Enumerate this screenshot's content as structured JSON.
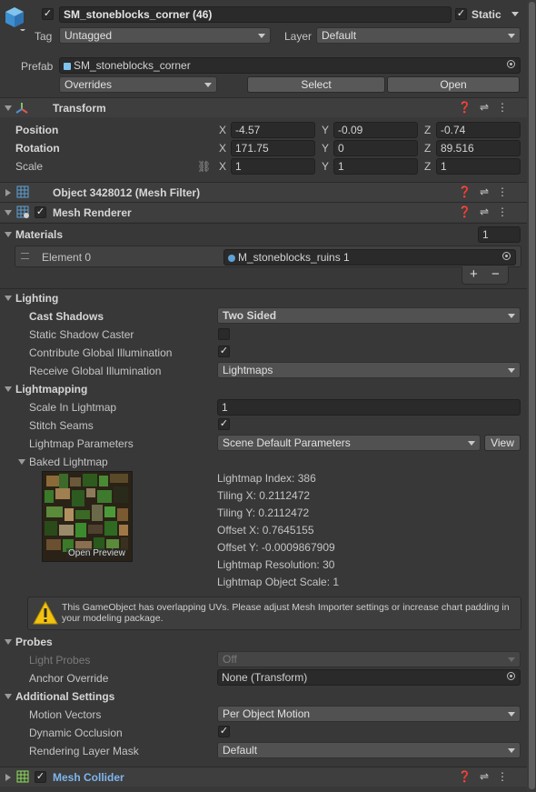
{
  "gameobject": {
    "name": "SM_stoneblocks_corner (46)",
    "static_label": "Static",
    "tag_label": "Tag",
    "tag_value": "Untagged",
    "layer_label": "Layer",
    "layer_value": "Default",
    "prefab_label": "Prefab",
    "prefab_value": "SM_stoneblocks_corner",
    "overrides_label": "Overrides",
    "select_label": "Select",
    "open_label": "Open"
  },
  "transform": {
    "title": "Transform",
    "position_label": "Position",
    "rotation_label": "Rotation",
    "scale_label": "Scale",
    "axis_x": "X",
    "axis_y": "Y",
    "axis_z": "Z",
    "position": {
      "x": "-4.57",
      "y": "-0.09",
      "z": "-0.74"
    },
    "rotation": {
      "x": "171.75",
      "y": "0",
      "z": "89.516"
    },
    "scale": {
      "x": "1",
      "y": "1",
      "z": "1"
    }
  },
  "mesh_filter": {
    "title": "Object 3428012 (Mesh Filter)"
  },
  "mesh_renderer": {
    "title": "Mesh Renderer",
    "materials_label": "Materials",
    "materials_count": "1",
    "element0_label": "Element 0",
    "element0_value": "M_stoneblocks_ruins 1",
    "add_label": "+",
    "remove_label": "−",
    "lighting_label": "Lighting",
    "cast_shadows_label": "Cast Shadows",
    "cast_shadows_value": "Two Sided",
    "static_shadow_caster_label": "Static Shadow Caster",
    "contribute_gi_label": "Contribute Global Illumination",
    "receive_gi_label": "Receive Global Illumination",
    "receive_gi_value": "Lightmaps",
    "lightmapping_label": "Lightmapping",
    "scale_in_lightmap_label": "Scale In Lightmap",
    "scale_in_lightmap_value": "1",
    "stitch_seams_label": "Stitch Seams",
    "lightmap_parameters_label": "Lightmap Parameters",
    "lightmap_parameters_value": "Scene Default Parameters",
    "view_label": "View",
    "baked_lightmap_label": "Baked Lightmap",
    "open_preview_label": "Open Preview",
    "lightmap_info": [
      "Lightmap Index: 386",
      "Tiling X: 0.2112472",
      "Tiling Y: 0.2112472",
      "Offset X: 0.7645155",
      "Offset Y: -0.0009867909",
      "Lightmap Resolution: 30",
      "Lightmap Object Scale: 1"
    ],
    "warning_text": "This GameObject has overlapping UVs. Please adjust Mesh Importer settings or increase chart padding in your modeling package.",
    "probes_label": "Probes",
    "light_probes_label": "Light Probes",
    "light_probes_value": "Off",
    "anchor_override_label": "Anchor Override",
    "anchor_override_value": "None (Transform)",
    "additional_settings_label": "Additional Settings",
    "motion_vectors_label": "Motion Vectors",
    "motion_vectors_value": "Per Object Motion",
    "dynamic_occlusion_label": "Dynamic Occlusion",
    "rendering_layer_mask_label": "Rendering Layer Mask",
    "rendering_layer_mask_value": "Default"
  },
  "mesh_collider": {
    "title": "Mesh Collider"
  },
  "colors": {
    "background": "#383838",
    "accent_blue": "#5ea1d6",
    "warning_yellow": "#f3c20f"
  }
}
